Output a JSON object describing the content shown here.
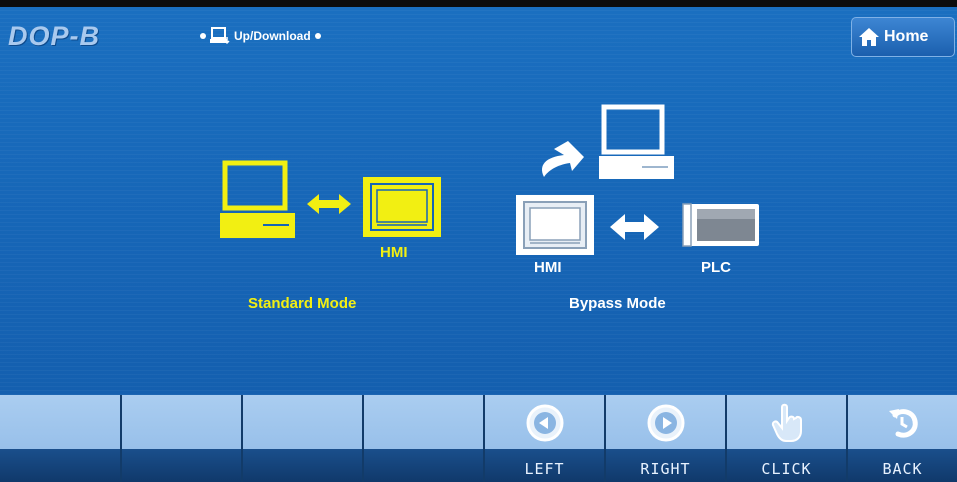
{
  "header": {
    "logo": "DOP-B",
    "section_title": "Up/Download",
    "home_label": "Home"
  },
  "modes": {
    "standard": {
      "label": "Standard Mode",
      "hmi_label": "HMI"
    },
    "bypass": {
      "label": "Bypass Mode",
      "hmi_label": "HMI",
      "plc_label": "PLC"
    }
  },
  "toolbar": {
    "buttons": [
      {
        "label": ""
      },
      {
        "label": ""
      },
      {
        "label": ""
      },
      {
        "label": ""
      },
      {
        "label": "LEFT",
        "icon": "left-arrow-circle-icon"
      },
      {
        "label": "RIGHT",
        "icon": "right-arrow-circle-icon"
      },
      {
        "label": "CLICK",
        "icon": "hand-pointer-icon"
      },
      {
        "label": "BACK",
        "icon": "back-rotate-icon"
      }
    ]
  },
  "colors": {
    "background": "#1665b6",
    "active_mode": "#f2ef12",
    "inactive_mode": "#ffffff"
  }
}
